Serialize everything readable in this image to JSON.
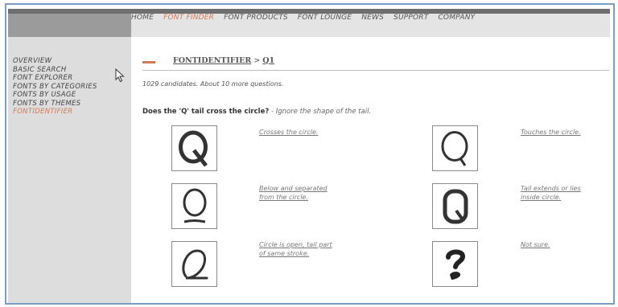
{
  "nav": {
    "items": [
      {
        "label": "HOME"
      },
      {
        "label": "FONT FINDER",
        "active": true
      },
      {
        "label": "FONT PRODUCTS"
      },
      {
        "label": "FONT LOUNGE"
      },
      {
        "label": "NEWS"
      },
      {
        "label": "SUPPORT"
      },
      {
        "label": "COMPANY"
      }
    ]
  },
  "sidebar": {
    "items": [
      {
        "label": "OVERVIEW"
      },
      {
        "label": "BASIC SEARCH"
      },
      {
        "label": "FONT EXPLORER"
      },
      {
        "label": "FONTS BY CATEGORIES"
      },
      {
        "label": "FONTS BY USAGE"
      },
      {
        "label": "FONTS BY THEMES"
      },
      {
        "label": "FONTIDENTIFIER",
        "active": true
      }
    ]
  },
  "breadcrumb": {
    "root": "FONTIDENTIFIER",
    "separator": ">",
    "current": "Q1"
  },
  "status": {
    "candidates": "1029 candidates. About 10 more questions."
  },
  "question": {
    "text": "Does the 'Q' tail cross the circle?",
    "hint": "- Ignore the shape of the tail."
  },
  "options": [
    {
      "glyph": "crosses-circle-q-icon",
      "label_line1": "Crosses the circle.",
      "label_line2": ""
    },
    {
      "glyph": "touches-circle-q-icon",
      "label_line1": "Touches the circle.",
      "label_line2": ""
    },
    {
      "glyph": "below-separated-q-icon",
      "label_line1": "Below and separated",
      "label_line2": "from the circle."
    },
    {
      "glyph": "inside-tail-q-icon",
      "label_line1": "Tail extends or lies",
      "label_line2": "inside circle."
    },
    {
      "glyph": "open-circle-q-icon",
      "label_line1": "Circle is open, tail part",
      "label_line2": "of same stroke."
    },
    {
      "glyph": "question-mark-icon",
      "label_line1": "Not sure.",
      "label_line2": ""
    }
  ],
  "colors": {
    "accent": "#d3795a",
    "frame_border": "#7b9ec8",
    "sidebar_bg": "#dcdddc",
    "nav_bg": "#e3e4e3"
  }
}
